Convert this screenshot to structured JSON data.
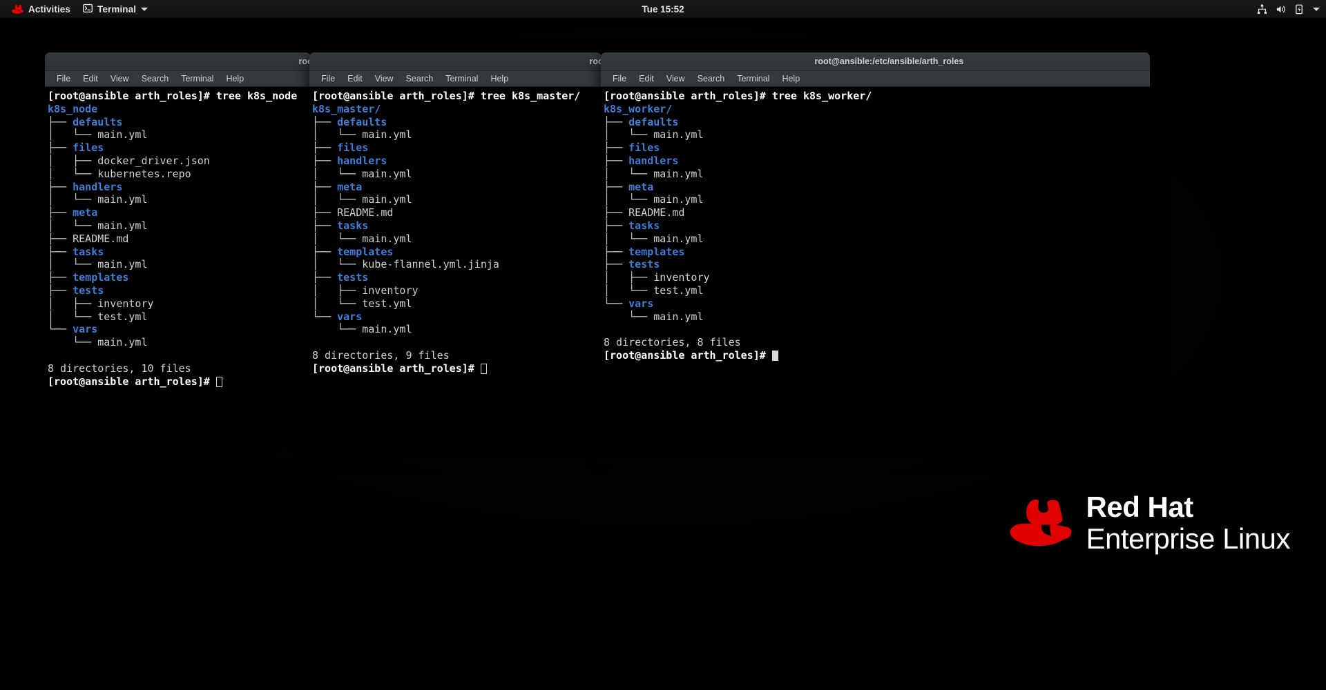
{
  "topbar": {
    "activities_label": "Activities",
    "app_menu_label": "Terminal",
    "clock": "Tue 15:52",
    "icons": {
      "redhat_logo": "redhat-logo-icon",
      "terminal_icon": "terminal-icon",
      "app_caret": "chevron-down-icon",
      "network": "network-icon",
      "volume": "volume-icon",
      "battery": "battery-charging-icon",
      "system_caret": "chevron-down-icon"
    }
  },
  "menu_items": [
    "File",
    "Edit",
    "View",
    "Search",
    "Terminal",
    "Help"
  ],
  "brand": {
    "line1": "Red Hat",
    "line2": "Enterprise Linux",
    "logo": "redhat-logo-icon"
  },
  "windows": [
    {
      "title": "root@ansible:",
      "command_line": "[root@ansible arth_roles]# tree k8s_node",
      "root": "k8s_node",
      "lines": [
        {
          "branch": "├── ",
          "name": "defaults",
          "type": "dir"
        },
        {
          "branch": "│   └── ",
          "name": "main.yml",
          "type": "file"
        },
        {
          "branch": "├── ",
          "name": "files",
          "type": "dir"
        },
        {
          "branch": "│   ├── ",
          "name": "docker_driver.json",
          "type": "file"
        },
        {
          "branch": "│   └── ",
          "name": "kubernetes.repo",
          "type": "file"
        },
        {
          "branch": "├── ",
          "name": "handlers",
          "type": "dir"
        },
        {
          "branch": "│   └── ",
          "name": "main.yml",
          "type": "file"
        },
        {
          "branch": "├── ",
          "name": "meta",
          "type": "dir"
        },
        {
          "branch": "│   └── ",
          "name": "main.yml",
          "type": "file"
        },
        {
          "branch": "├── ",
          "name": "README.md",
          "type": "file"
        },
        {
          "branch": "├── ",
          "name": "tasks",
          "type": "dir"
        },
        {
          "branch": "│   └── ",
          "name": "main.yml",
          "type": "file"
        },
        {
          "branch": "├── ",
          "name": "templates",
          "type": "dir"
        },
        {
          "branch": "├── ",
          "name": "tests",
          "type": "dir"
        },
        {
          "branch": "│   ├── ",
          "name": "inventory",
          "type": "file"
        },
        {
          "branch": "│   └── ",
          "name": "test.yml",
          "type": "file"
        },
        {
          "branch": "└── ",
          "name": "vars",
          "type": "dir"
        },
        {
          "branch": "    └── ",
          "name": "main.yml",
          "type": "file"
        }
      ],
      "summary": "8 directories, 10 files",
      "prompt": "[root@ansible arth_roles]# ",
      "cursor": "hollow"
    },
    {
      "title": "root@ansible:/etc/an",
      "command_line": "[root@ansible arth_roles]# tree k8s_master/",
      "root": "k8s_master/",
      "lines": [
        {
          "branch": "├── ",
          "name": "defaults",
          "type": "dir"
        },
        {
          "branch": "│   └── ",
          "name": "main.yml",
          "type": "file"
        },
        {
          "branch": "├── ",
          "name": "files",
          "type": "dir"
        },
        {
          "branch": "├── ",
          "name": "handlers",
          "type": "dir"
        },
        {
          "branch": "│   └── ",
          "name": "main.yml",
          "type": "file"
        },
        {
          "branch": "├── ",
          "name": "meta",
          "type": "dir"
        },
        {
          "branch": "│   └── ",
          "name": "main.yml",
          "type": "file"
        },
        {
          "branch": "├── ",
          "name": "README.md",
          "type": "file"
        },
        {
          "branch": "├── ",
          "name": "tasks",
          "type": "dir"
        },
        {
          "branch": "│   └── ",
          "name": "main.yml",
          "type": "file"
        },
        {
          "branch": "├── ",
          "name": "templates",
          "type": "dir"
        },
        {
          "branch": "│   └── ",
          "name": "kube-flannel.yml.jinja",
          "type": "file"
        },
        {
          "branch": "├── ",
          "name": "tests",
          "type": "dir"
        },
        {
          "branch": "│   ├── ",
          "name": "inventory",
          "type": "file"
        },
        {
          "branch": "│   └── ",
          "name": "test.yml",
          "type": "file"
        },
        {
          "branch": "└── ",
          "name": "vars",
          "type": "dir"
        },
        {
          "branch": "    └── ",
          "name": "main.yml",
          "type": "file"
        }
      ],
      "summary": "8 directories, 9 files",
      "prompt": "[root@ansible arth_roles]# ",
      "cursor": "hollow"
    },
    {
      "title": "root@ansible:/etc/ansible/arth_roles",
      "command_line": "[root@ansible arth_roles]# tree k8s_worker/",
      "root": "k8s_worker/",
      "lines": [
        {
          "branch": "├── ",
          "name": "defaults",
          "type": "dir"
        },
        {
          "branch": "│   └── ",
          "name": "main.yml",
          "type": "file"
        },
        {
          "branch": "├── ",
          "name": "files",
          "type": "dir"
        },
        {
          "branch": "├── ",
          "name": "handlers",
          "type": "dir"
        },
        {
          "branch": "│   └── ",
          "name": "main.yml",
          "type": "file"
        },
        {
          "branch": "├── ",
          "name": "meta",
          "type": "dir"
        },
        {
          "branch": "│   └── ",
          "name": "main.yml",
          "type": "file"
        },
        {
          "branch": "├── ",
          "name": "README.md",
          "type": "file"
        },
        {
          "branch": "├── ",
          "name": "tasks",
          "type": "dir"
        },
        {
          "branch": "│   └── ",
          "name": "main.yml",
          "type": "file"
        },
        {
          "branch": "├── ",
          "name": "templates",
          "type": "dir"
        },
        {
          "branch": "├── ",
          "name": "tests",
          "type": "dir"
        },
        {
          "branch": "│   ├── ",
          "name": "inventory",
          "type": "file"
        },
        {
          "branch": "│   └── ",
          "name": "test.yml",
          "type": "file"
        },
        {
          "branch": "└── ",
          "name": "vars",
          "type": "dir"
        },
        {
          "branch": "    └── ",
          "name": "main.yml",
          "type": "file"
        }
      ],
      "summary": "8 directories, 8 files",
      "prompt": "[root@ansible arth_roles]# ",
      "cursor": "solid"
    }
  ]
}
